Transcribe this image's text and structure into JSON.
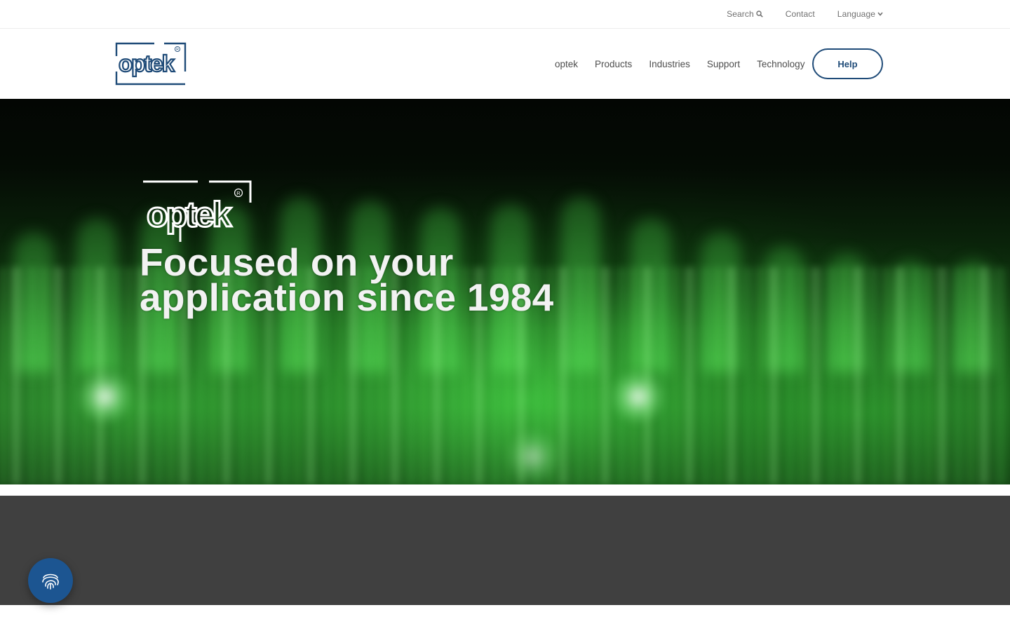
{
  "topbar": {
    "search_label": "Search",
    "search_icon": "search-icon",
    "contact_label": "Contact",
    "language_label": "Language",
    "language_icon": "chevron-down-icon"
  },
  "header": {
    "logo_text": "optek",
    "nav": [
      {
        "label": "optek"
      },
      {
        "label": "Products"
      },
      {
        "label": "Industries"
      },
      {
        "label": "Support"
      },
      {
        "label": "Technology"
      }
    ],
    "help_label": "Help",
    "brand_color": "#1f4b78"
  },
  "hero": {
    "logo_text": "optek",
    "title_line1": "Focused on your",
    "title_line2": "application since 1984"
  },
  "privacy_button": {
    "icon": "fingerprint-icon",
    "color": "#1c5591"
  },
  "colors": {
    "dark_band": "#404040",
    "hero_green": "#3fd93f"
  }
}
